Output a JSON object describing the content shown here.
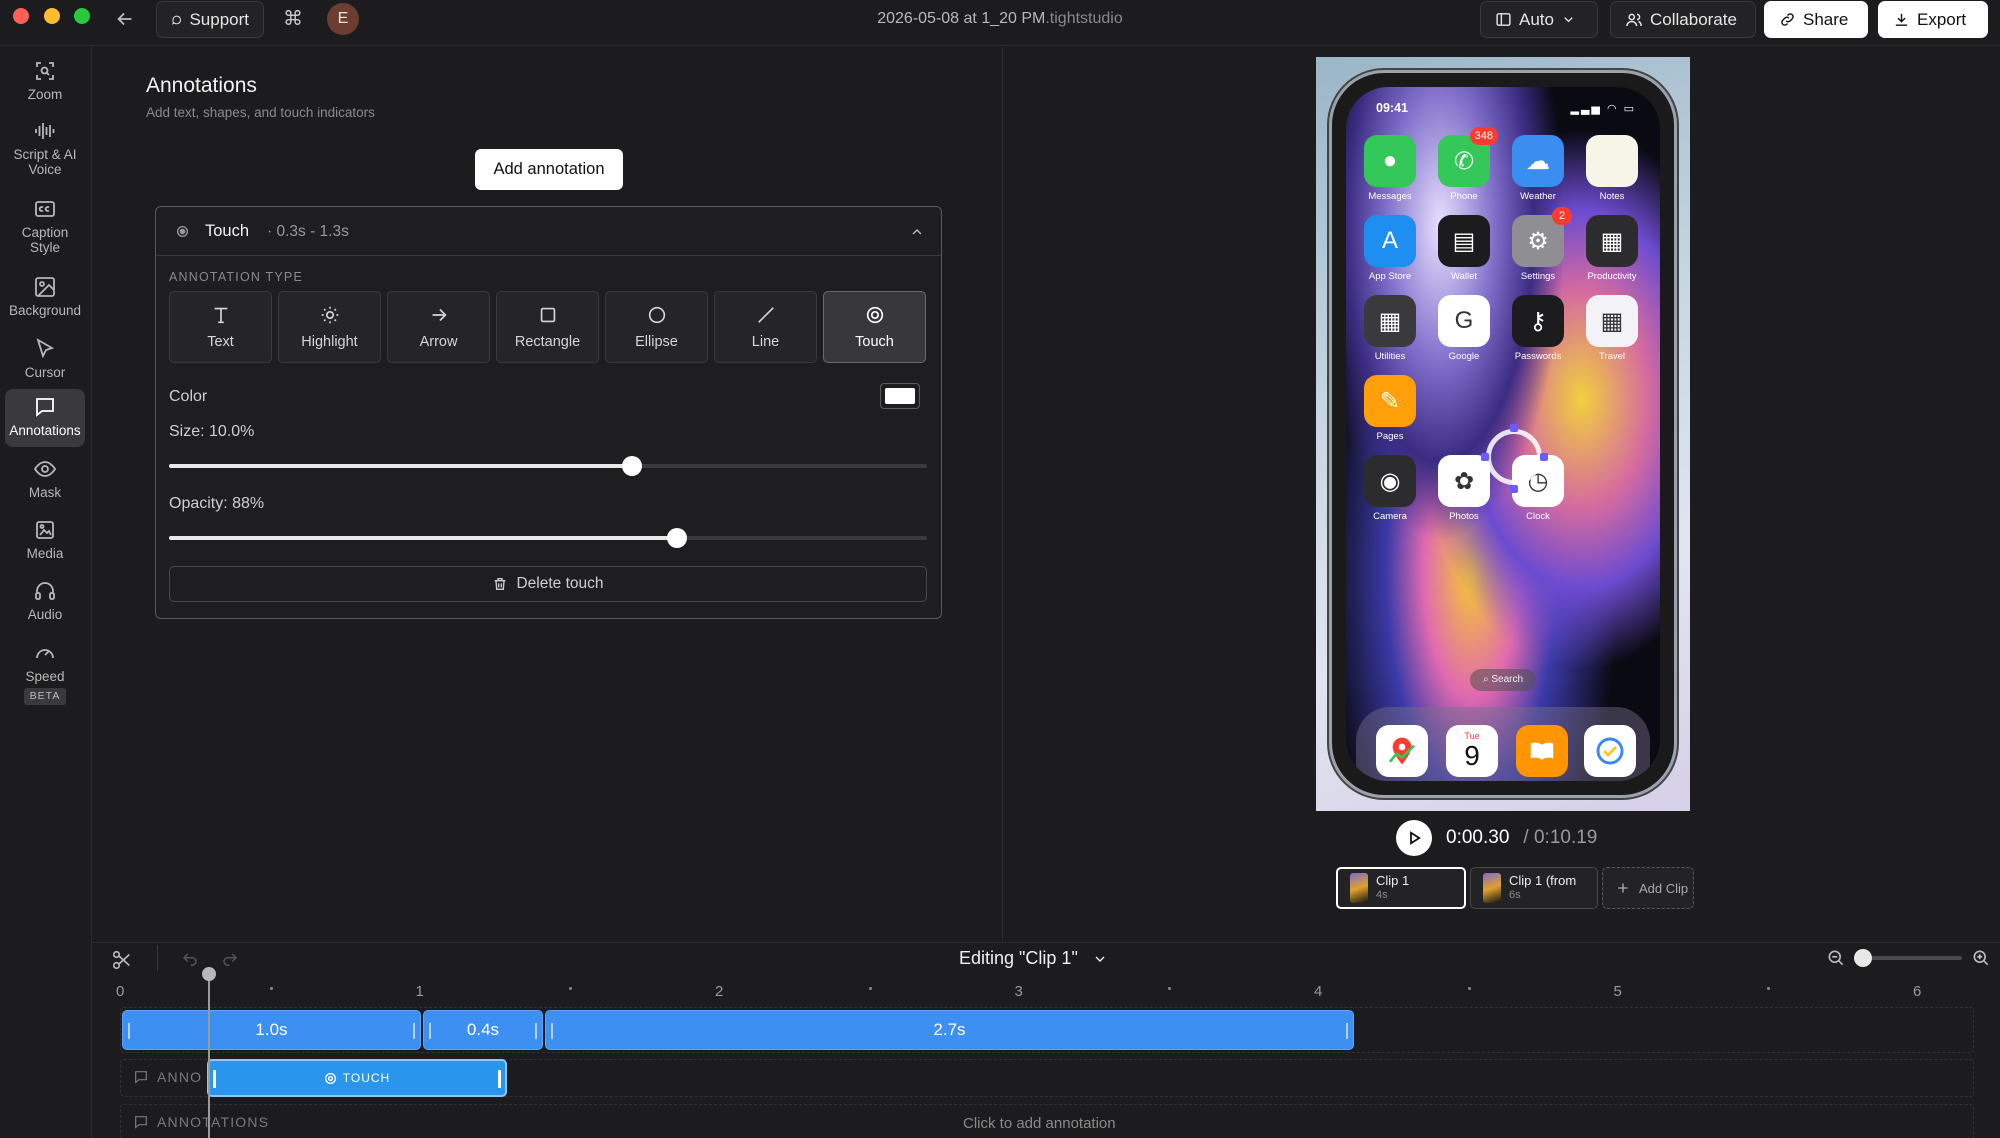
{
  "window": {
    "title": "2026-05-08 at 1_20 PM",
    "title_ext": ".tightstudio"
  },
  "topbar": {
    "support_label": "Support",
    "avatar_initial": "E",
    "auto_label": "Auto",
    "collaborate_label": "Collaborate",
    "share_label": "Share",
    "export_label": "Export"
  },
  "sidebar": {
    "items": [
      {
        "label": "Zoom",
        "icon": "zoom-icon"
      },
      {
        "label": "Script & AI Voice",
        "icon": "waveform-icon"
      },
      {
        "label": "Caption Style",
        "icon": "caption-icon"
      },
      {
        "label": "Background",
        "icon": "image-icon"
      },
      {
        "label": "Cursor",
        "icon": "cursor-icon"
      },
      {
        "label": "Annotations",
        "icon": "chat-icon",
        "active": true
      },
      {
        "label": "Mask",
        "icon": "eye-icon"
      },
      {
        "label": "Media",
        "icon": "media-icon"
      },
      {
        "label": "Audio",
        "icon": "headphones-icon"
      },
      {
        "label": "Speed",
        "icon": "gauge-icon",
        "badge": "BETA"
      }
    ]
  },
  "panel": {
    "title": "Annotations",
    "subtitle": "Add text, shapes, and touch indicators",
    "add_label": "Add annotation",
    "card": {
      "name": "Touch",
      "range": "· 0.3s - 1.3s",
      "type_label": "ANNOTATION TYPE",
      "types": [
        {
          "label": "Text",
          "icon": "text-icon"
        },
        {
          "label": "Highlight",
          "icon": "sun-icon"
        },
        {
          "label": "Arrow",
          "icon": "arrow-right-icon"
        },
        {
          "label": "Rectangle",
          "icon": "square-icon"
        },
        {
          "label": "Ellipse",
          "icon": "circle-icon"
        },
        {
          "label": "Line",
          "icon": "line-icon"
        },
        {
          "label": "Touch",
          "icon": "touch-icon",
          "active": true
        }
      ],
      "color_label": "Color",
      "color_value": "#ffffff",
      "size_label": "Size: 10.0%",
      "size_fraction": 0.611,
      "opacity_label": "Opacity: 88%",
      "opacity_fraction": 0.67,
      "delete_label": "Delete touch"
    }
  },
  "phone": {
    "time": "09:41",
    "apps": [
      {
        "label": "Messages",
        "color": "#34c759",
        "glyph": "●"
      },
      {
        "label": "Phone",
        "color": "#34c759",
        "glyph": "✆",
        "badge": "348"
      },
      {
        "label": "Weather",
        "color": "#3a8ef0",
        "glyph": "☁"
      },
      {
        "label": "Notes",
        "color": "#f7f4e8",
        "glyph": ""
      },
      {
        "label": "App Store",
        "color": "#1f8ef1",
        "glyph": "A"
      },
      {
        "label": "Wallet",
        "color": "#1c1c1e",
        "glyph": "▤"
      },
      {
        "label": "Settings",
        "color": "#8e8e93",
        "glyph": "⚙",
        "badge": "2"
      },
      {
        "label": "Productivity",
        "color": "#2c2c2e",
        "glyph": "▦"
      },
      {
        "label": "Utilities",
        "color": "#3a3a3c",
        "glyph": "▦"
      },
      {
        "label": "Google",
        "color": "#ffffff",
        "glyph": "G"
      },
      {
        "label": "Passwords",
        "color": "#1c1c1e",
        "glyph": "⚷"
      },
      {
        "label": "Travel",
        "color": "#f2f2f7",
        "glyph": "▦"
      },
      {
        "label": "Pages",
        "color": "#ff9f0a",
        "glyph": "✎"
      },
      {
        "label": "Camera",
        "color": "#2c2c2e",
        "glyph": "◉"
      },
      {
        "label": "Photos",
        "color": "#ffffff",
        "glyph": "✿"
      },
      {
        "label": "Clock",
        "color": "#ffffff",
        "glyph": "◷"
      }
    ],
    "search_label": "Search",
    "dock": [
      {
        "icon": "maps-icon",
        "color": "#ffffff"
      },
      {
        "icon": "calendar-icon",
        "color": "#ffffff",
        "day": "Tue",
        "date": "9"
      },
      {
        "icon": "books-icon",
        "color": "#ff9500"
      },
      {
        "icon": "reminders-icon",
        "color": "#ffffff"
      }
    ]
  },
  "playback": {
    "current": "0:00.30",
    "separator": "/",
    "total": "0:10.19"
  },
  "clips": [
    {
      "name": "Clip 1",
      "duration": "4s",
      "active": true
    },
    {
      "name": "Clip 1 (from",
      "duration": "6s"
    },
    {
      "name": "Add Clip"
    }
  ],
  "timeline": {
    "editing_label": "Editing \"Clip 1\"",
    "ticks": [
      "0",
      "1",
      "2",
      "3",
      "4",
      "5",
      "6"
    ],
    "segments": [
      "1.0s",
      "0.4s",
      "2.7s"
    ],
    "lane_label": "ANNOTATIONS",
    "lane_label_short": "ANNO",
    "touch_label": "TOUCH",
    "click_add": "Click to add annotation"
  },
  "colors": {
    "accent": "#3d8ff2",
    "touch_block": "#2a95ec"
  }
}
